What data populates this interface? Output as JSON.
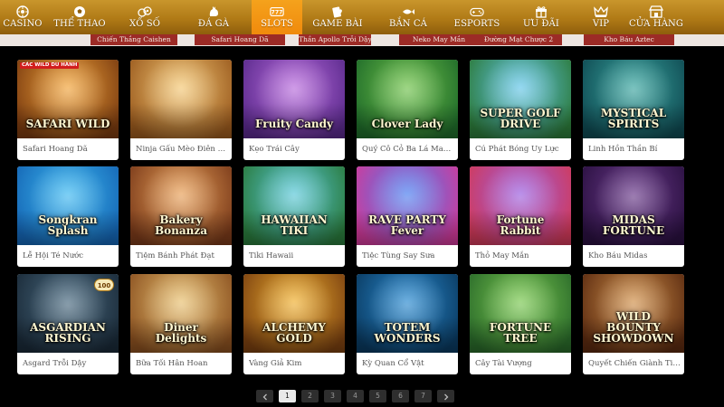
{
  "nav": {
    "items": [
      {
        "label": "CASINO",
        "icon": "roulette-icon"
      },
      {
        "label": "THỂ THAO",
        "icon": "soccer-ball-icon"
      },
      {
        "label": "XỔ SỐ",
        "icon": "lottery-balls-icon"
      },
      {
        "label": "ĐÁ GÀ",
        "icon": "rooster-icon"
      },
      {
        "label": "SLOTS",
        "icon": "slot-777-icon",
        "active": true
      },
      {
        "label": "GAME BÀI",
        "icon": "playing-cards-icon"
      },
      {
        "label": "BẮN CÁ",
        "icon": "fish-icon"
      },
      {
        "label": "ESPORTS",
        "icon": "gamepad-icon"
      },
      {
        "label": "ƯU ĐÃI",
        "icon": "gift-icon"
      },
      {
        "label": "VIP",
        "icon": "crown-icon"
      },
      {
        "label": "CỬA HÀNG",
        "icon": "shop-icon"
      }
    ]
  },
  "subtabs": [
    "Chiến Thắng Caishen",
    "Safari Hoang Dã",
    "Thần Apollo Trỗi Dậy",
    "Neko May Mắn",
    "Đường Mạt Chược 2",
    "Kho Báu Aztec"
  ],
  "games": [
    {
      "name": "Safari Hoang Dã",
      "art": "SAFARI WILD",
      "badge": "CÁC WILD DU HÀNH",
      "colors": [
        "#f2a43a",
        "#7a3b10"
      ]
    },
    {
      "name": "Ninja Gấu Mèo Điên Cuồng",
      "art": "",
      "colors": [
        "#f4c875",
        "#9a5a1e"
      ]
    },
    {
      "name": "Kẹo Trái Cây",
      "art": "Fruity Candy",
      "colors": [
        "#b86bdc",
        "#5a2a8c"
      ]
    },
    {
      "name": "Quý Cô Cỏ Ba Lá May Mắn",
      "art": "Clover Lady",
      "colors": [
        "#6fc24a",
        "#1f6b2a"
      ]
    },
    {
      "name": "Cú Phát Bóng Uy Lực",
      "art": "SUPER GOLF DRIVE",
      "colors": [
        "#63c6ea",
        "#2c7a3a"
      ]
    },
    {
      "name": "Linh Hồn Thần Bí",
      "art": "MYSTICAL SPIRITS",
      "colors": [
        "#3aa6a0",
        "#0f4a52"
      ]
    },
    {
      "name": "Lễ Hội Té Nước",
      "art": "Songkran Splash",
      "colors": [
        "#3db8f0",
        "#1566b5"
      ]
    },
    {
      "name": "Tiệm Bánh Phát Đạt",
      "art": "Bakery Bonanza",
      "colors": [
        "#e8a058",
        "#7a3a1a"
      ]
    },
    {
      "name": "Tiki Hawaii",
      "art": "HAWAIIAN TIKI",
      "colors": [
        "#58c7d8",
        "#2a7a3c"
      ]
    },
    {
      "name": "Tiệc Tùng Say Sưa",
      "art": "RAVE PARTY Fever",
      "colors": [
        "#4a7ef0",
        "#d03a9a"
      ]
    },
    {
      "name": "Thỏ May Mắn",
      "art": "Fortune Rabbit",
      "colors": [
        "#9a5ee0",
        "#d13a5a"
      ]
    },
    {
      "name": "Kho Báu Midas",
      "art": "MIDAS FORTUNE",
      "colors": [
        "#6a3a8a",
        "#2a1040"
      ]
    },
    {
      "name": "Asgard Trỗi Dậy",
      "art": "ASGARDIAN RISING",
      "colors": [
        "#4a6a80",
        "#1a2a38"
      ],
      "chip": "100"
    },
    {
      "name": "Bữa Tối Hân Hoan",
      "art": "Diner Delights",
      "colors": [
        "#e8c070",
        "#8a5020"
      ]
    },
    {
      "name": "Vàng Giả Kim",
      "art": "ALCHEMY GOLD",
      "colors": [
        "#f0b030",
        "#7a4010"
      ]
    },
    {
      "name": "Kỳ Quan Cổ Vật",
      "art": "TOTEM WONDERS",
      "colors": [
        "#2a8ad0",
        "#0a3a60"
      ]
    },
    {
      "name": "Cây Tài Vượng",
      "art": "FORTUNE TREE",
      "colors": [
        "#7ac850",
        "#2a6a2a"
      ]
    },
    {
      "name": "Quyết Chiến Giành Tiền Thưởng",
      "art": "WILD BOUNTY SHOWDOWN",
      "colors": [
        "#d0904a",
        "#5a2a10"
      ]
    }
  ],
  "pagination": {
    "prev_icon": "chevron-left-icon",
    "next_icon": "chevron-right-icon",
    "pages": [
      "1",
      "2",
      "3",
      "4",
      "5",
      "6",
      "7"
    ],
    "current": "1"
  }
}
